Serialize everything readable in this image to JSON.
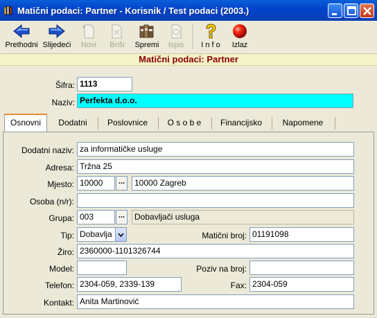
{
  "window": {
    "title": "Matični podaci: Partner - Korisnik / Test podaci (2003.)"
  },
  "toolbar": {
    "prev": "Prethodni",
    "next": "Slijedeći",
    "new": "Novi",
    "delete": "Briši",
    "save": "Spremi",
    "print": "Ispis",
    "info": "I n f o",
    "exit": "Izlaz"
  },
  "header": {
    "title": "Matični podaci: Partner"
  },
  "partner": {
    "sifra_label": "Šifra:",
    "sifra": "1113",
    "naziv_label": "Naziv:",
    "naziv": "Perfekta d.o.o."
  },
  "tabs": [
    "Osnovni",
    "Dodatni",
    "Poslovnice",
    "O s o b e",
    "Financijsko",
    "Napomene"
  ],
  "form": {
    "dodatni_naziv_label": "Dodatni naziv:",
    "dodatni_naziv": "za informatičke usluge",
    "adresa_label": "Adresa:",
    "adresa": "Tržna 25",
    "mjesto_label": "Mjesto:",
    "mjesto_code": "10000",
    "mjesto_name": "10000 Zagreb",
    "osoba_label": "Osoba (n/r):",
    "osoba": "",
    "grupa_label": "Grupa:",
    "grupa_code": "003",
    "grupa_name": "Dobavljači usluga",
    "tip_label": "Tip:",
    "tip": "Dobavlja",
    "maticni_label": "Matični broj:",
    "maticni": "01191098",
    "ziro_label": "Žiro:",
    "ziro": "2360000-1101326744",
    "model_label": "Model:",
    "model": "",
    "poziv_label": "Poziv na broj:",
    "poziv": "",
    "telefon_label": "Telefon:",
    "telefon": "2304-059, 2339-139",
    "fax_label": "Fax:",
    "fax": "2304-059",
    "kontakt_label": "Kontakt:",
    "kontakt": "Anita Martinović"
  },
  "colors": {
    "naziv_bg": "#00ffff",
    "header_text": "#8b0000",
    "header_bg": "#f4f2c8"
  }
}
